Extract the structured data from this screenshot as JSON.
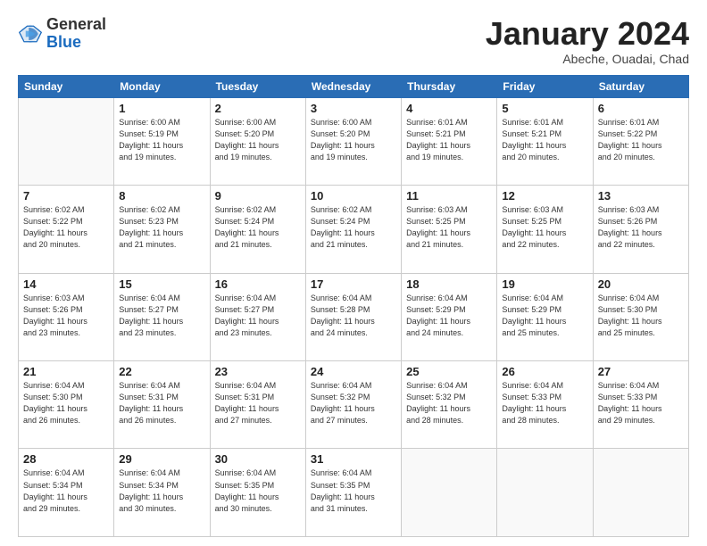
{
  "logo": {
    "general": "General",
    "blue": "Blue"
  },
  "header": {
    "title": "January 2024",
    "subtitle": "Abeche, Ouadai, Chad"
  },
  "weekdays": [
    "Sunday",
    "Monday",
    "Tuesday",
    "Wednesday",
    "Thursday",
    "Friday",
    "Saturday"
  ],
  "weeks": [
    [
      {
        "day": null,
        "info": null
      },
      {
        "day": "1",
        "info": "Sunrise: 6:00 AM\nSunset: 5:19 PM\nDaylight: 11 hours\nand 19 minutes."
      },
      {
        "day": "2",
        "info": "Sunrise: 6:00 AM\nSunset: 5:20 PM\nDaylight: 11 hours\nand 19 minutes."
      },
      {
        "day": "3",
        "info": "Sunrise: 6:00 AM\nSunset: 5:20 PM\nDaylight: 11 hours\nand 19 minutes."
      },
      {
        "day": "4",
        "info": "Sunrise: 6:01 AM\nSunset: 5:21 PM\nDaylight: 11 hours\nand 19 minutes."
      },
      {
        "day": "5",
        "info": "Sunrise: 6:01 AM\nSunset: 5:21 PM\nDaylight: 11 hours\nand 20 minutes."
      },
      {
        "day": "6",
        "info": "Sunrise: 6:01 AM\nSunset: 5:22 PM\nDaylight: 11 hours\nand 20 minutes."
      }
    ],
    [
      {
        "day": "7",
        "info": "Sunrise: 6:02 AM\nSunset: 5:22 PM\nDaylight: 11 hours\nand 20 minutes."
      },
      {
        "day": "8",
        "info": "Sunrise: 6:02 AM\nSunset: 5:23 PM\nDaylight: 11 hours\nand 21 minutes."
      },
      {
        "day": "9",
        "info": "Sunrise: 6:02 AM\nSunset: 5:24 PM\nDaylight: 11 hours\nand 21 minutes."
      },
      {
        "day": "10",
        "info": "Sunrise: 6:02 AM\nSunset: 5:24 PM\nDaylight: 11 hours\nand 21 minutes."
      },
      {
        "day": "11",
        "info": "Sunrise: 6:03 AM\nSunset: 5:25 PM\nDaylight: 11 hours\nand 21 minutes."
      },
      {
        "day": "12",
        "info": "Sunrise: 6:03 AM\nSunset: 5:25 PM\nDaylight: 11 hours\nand 22 minutes."
      },
      {
        "day": "13",
        "info": "Sunrise: 6:03 AM\nSunset: 5:26 PM\nDaylight: 11 hours\nand 22 minutes."
      }
    ],
    [
      {
        "day": "14",
        "info": "Sunrise: 6:03 AM\nSunset: 5:26 PM\nDaylight: 11 hours\nand 23 minutes."
      },
      {
        "day": "15",
        "info": "Sunrise: 6:04 AM\nSunset: 5:27 PM\nDaylight: 11 hours\nand 23 minutes."
      },
      {
        "day": "16",
        "info": "Sunrise: 6:04 AM\nSunset: 5:27 PM\nDaylight: 11 hours\nand 23 minutes."
      },
      {
        "day": "17",
        "info": "Sunrise: 6:04 AM\nSunset: 5:28 PM\nDaylight: 11 hours\nand 24 minutes."
      },
      {
        "day": "18",
        "info": "Sunrise: 6:04 AM\nSunset: 5:29 PM\nDaylight: 11 hours\nand 24 minutes."
      },
      {
        "day": "19",
        "info": "Sunrise: 6:04 AM\nSunset: 5:29 PM\nDaylight: 11 hours\nand 25 minutes."
      },
      {
        "day": "20",
        "info": "Sunrise: 6:04 AM\nSunset: 5:30 PM\nDaylight: 11 hours\nand 25 minutes."
      }
    ],
    [
      {
        "day": "21",
        "info": "Sunrise: 6:04 AM\nSunset: 5:30 PM\nDaylight: 11 hours\nand 26 minutes."
      },
      {
        "day": "22",
        "info": "Sunrise: 6:04 AM\nSunset: 5:31 PM\nDaylight: 11 hours\nand 26 minutes."
      },
      {
        "day": "23",
        "info": "Sunrise: 6:04 AM\nSunset: 5:31 PM\nDaylight: 11 hours\nand 27 minutes."
      },
      {
        "day": "24",
        "info": "Sunrise: 6:04 AM\nSunset: 5:32 PM\nDaylight: 11 hours\nand 27 minutes."
      },
      {
        "day": "25",
        "info": "Sunrise: 6:04 AM\nSunset: 5:32 PM\nDaylight: 11 hours\nand 28 minutes."
      },
      {
        "day": "26",
        "info": "Sunrise: 6:04 AM\nSunset: 5:33 PM\nDaylight: 11 hours\nand 28 minutes."
      },
      {
        "day": "27",
        "info": "Sunrise: 6:04 AM\nSunset: 5:33 PM\nDaylight: 11 hours\nand 29 minutes."
      }
    ],
    [
      {
        "day": "28",
        "info": "Sunrise: 6:04 AM\nSunset: 5:34 PM\nDaylight: 11 hours\nand 29 minutes."
      },
      {
        "day": "29",
        "info": "Sunrise: 6:04 AM\nSunset: 5:34 PM\nDaylight: 11 hours\nand 30 minutes."
      },
      {
        "day": "30",
        "info": "Sunrise: 6:04 AM\nSunset: 5:35 PM\nDaylight: 11 hours\nand 30 minutes."
      },
      {
        "day": "31",
        "info": "Sunrise: 6:04 AM\nSunset: 5:35 PM\nDaylight: 11 hours\nand 31 minutes."
      },
      {
        "day": null,
        "info": null
      },
      {
        "day": null,
        "info": null
      },
      {
        "day": null,
        "info": null
      }
    ]
  ]
}
